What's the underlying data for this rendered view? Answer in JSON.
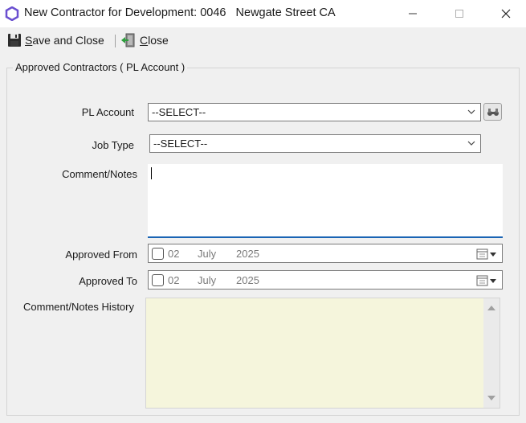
{
  "window": {
    "title": "New Contractor for Development: 0046   Newgate Street CA",
    "controls": [
      "minimize-icon",
      "maximize-icon",
      "close-icon"
    ]
  },
  "toolbar": {
    "save_close_prefix": "S",
    "save_close_rest": "ave and Close",
    "close_prefix": "C",
    "close_rest": "lose"
  },
  "group": {
    "title": "Approved Contractors ( PL Account )"
  },
  "form": {
    "pl_account": {
      "label": "PL Account",
      "value": "--SELECT--"
    },
    "job_type": {
      "label": "Job Type",
      "value": "--SELECT--"
    },
    "comment": {
      "label": "Comment/Notes",
      "value": ""
    },
    "approved_from": {
      "label": "Approved From",
      "day": "02",
      "month": "July",
      "year": "2025"
    },
    "approved_to": {
      "label": "Approved To",
      "day": "02",
      "month": "July",
      "year": "2025"
    },
    "history": {
      "label": "Comment/Notes History",
      "value": ""
    }
  },
  "colors": {
    "history_bg": "#f5f5dc",
    "focus_border": "#1a64b4",
    "app_icon": "#6a4fd0"
  }
}
